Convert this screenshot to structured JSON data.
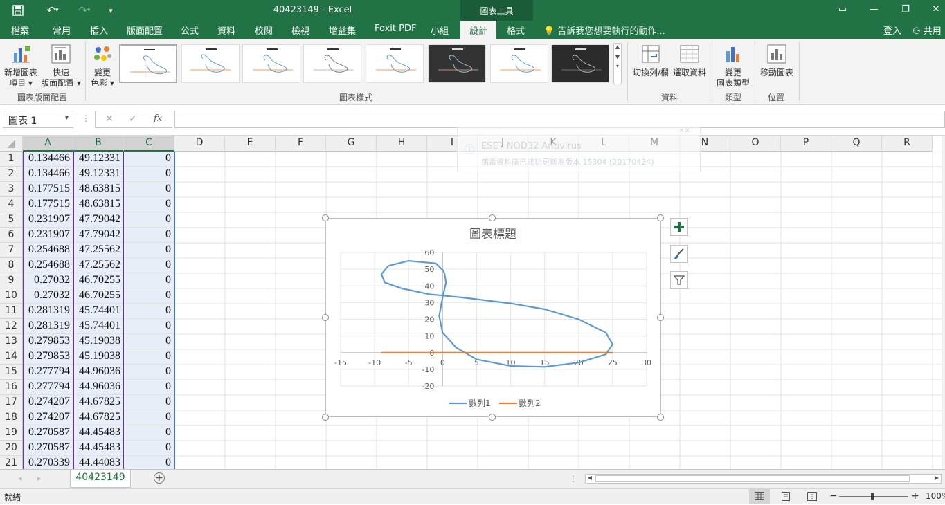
{
  "window": {
    "title": "40423149 - Excel",
    "chart_tools_label": "圖表工具",
    "signin": "登入",
    "share": "共用"
  },
  "tabs": [
    "檔案",
    "常用",
    "插入",
    "版面配置",
    "公式",
    "資料",
    "校閱",
    "檢視",
    "增益集",
    "Foxit PDF",
    "小組",
    "設計",
    "格式"
  ],
  "active_tab": "設計",
  "tell_me": "告訴我您想要執行的動作...",
  "ribbon": {
    "add_element": [
      "新增圖表",
      "項目"
    ],
    "quick_layout": [
      "快速",
      "版面配置"
    ],
    "group_layouts": "圖表版面配置",
    "change_colors": [
      "變更",
      "色彩"
    ],
    "group_styles": "圖表樣式",
    "switch_row_col": "切換列/欄",
    "select_data": "選取資料",
    "group_data": "資料",
    "change_type": [
      "變更",
      "圖表類型"
    ],
    "group_type": "類型",
    "move_chart": "移動圖表",
    "group_location": "位置"
  },
  "formula_bar": {
    "name_box": "圖表 1",
    "fx": "fx",
    "cancel": "✕",
    "enter": "✓"
  },
  "columns": [
    "A",
    "B",
    "C",
    "D",
    "E",
    "F",
    "G",
    "H",
    "I",
    "J",
    "K",
    "L",
    "M",
    "N",
    "O",
    "P",
    "Q",
    "R"
  ],
  "rows": [
    {
      "n": "1",
      "a": "0.134466",
      "b": "49.12331",
      "c": "0"
    },
    {
      "n": "2",
      "a": "0.134466",
      "b": "49.12331",
      "c": "0"
    },
    {
      "n": "3",
      "a": "0.177515",
      "b": "48.63815",
      "c": "0"
    },
    {
      "n": "4",
      "a": "0.177515",
      "b": "48.63815",
      "c": "0"
    },
    {
      "n": "5",
      "a": "0.231907",
      "b": "47.79042",
      "c": "0"
    },
    {
      "n": "6",
      "a": "0.231907",
      "b": "47.79042",
      "c": "0"
    },
    {
      "n": "7",
      "a": "0.254688",
      "b": "47.25562",
      "c": "0"
    },
    {
      "n": "8",
      "a": "0.254688",
      "b": "47.25562",
      "c": "0"
    },
    {
      "n": "9",
      "a": "0.27032",
      "b": "46.70255",
      "c": "0"
    },
    {
      "n": "10",
      "a": "0.27032",
      "b": "46.70255",
      "c": "0"
    },
    {
      "n": "11",
      "a": "0.281319",
      "b": "45.74401",
      "c": "0"
    },
    {
      "n": "12",
      "a": "0.281319",
      "b": "45.74401",
      "c": "0"
    },
    {
      "n": "13",
      "a": "0.279853",
      "b": "45.19038",
      "c": "0"
    },
    {
      "n": "14",
      "a": "0.279853",
      "b": "45.19038",
      "c": "0"
    },
    {
      "n": "15",
      "a": "0.277794",
      "b": "44.96036",
      "c": "0"
    },
    {
      "n": "16",
      "a": "0.277794",
      "b": "44.96036",
      "c": "0"
    },
    {
      "n": "17",
      "a": "0.274207",
      "b": "44.67825",
      "c": "0"
    },
    {
      "n": "18",
      "a": "0.274207",
      "b": "44.67825",
      "c": "0"
    },
    {
      "n": "19",
      "a": "0.270587",
      "b": "44.45483",
      "c": "0"
    },
    {
      "n": "20",
      "a": "0.270587",
      "b": "44.45483",
      "c": "0"
    },
    {
      "n": "21",
      "a": "0.270339",
      "b": "44.44083",
      "c": "0"
    }
  ],
  "notification": {
    "title": "ESET NOD32 Antivirus",
    "body": "病毒資料庫已成功更新為版本 15304 (20170424)"
  },
  "chart_data": {
    "type": "scatter",
    "title": "圖表標題",
    "xlim": [
      -15,
      30
    ],
    "ylim": [
      -20,
      60
    ],
    "xticks": [
      -15,
      -10,
      -5,
      0,
      5,
      10,
      15,
      20,
      25,
      30
    ],
    "yticks": [
      -20,
      -10,
      0,
      10,
      20,
      30,
      40,
      50,
      60
    ],
    "grid": true,
    "legend_position": "bottom",
    "series": [
      {
        "name": "數列1",
        "color": "#5b9bd5",
        "x": [
          0.1,
          -1,
          -5,
          -8,
          -9,
          -8.5,
          -6,
          -2,
          3,
          10,
          15,
          20,
          24,
          25,
          24,
          20,
          15,
          10,
          5,
          2,
          0,
          -0.5,
          0,
          0.5,
          0.3,
          0.1
        ],
        "y": [
          49.1,
          53.5,
          55,
          52,
          47,
          42,
          38.5,
          35,
          33,
          29.5,
          26,
          20,
          12,
          5,
          -1,
          -6,
          -8.5,
          -8,
          -4,
          3,
          12,
          22,
          33,
          42,
          47,
          49.1
        ]
      },
      {
        "name": "數列2",
        "color": "#ed7d31",
        "x": [
          -9,
          25
        ],
        "y": [
          0,
          0
        ]
      }
    ]
  },
  "sheet_tab": "40423149",
  "status": {
    "ready": "就緒",
    "zoom": "100%"
  }
}
